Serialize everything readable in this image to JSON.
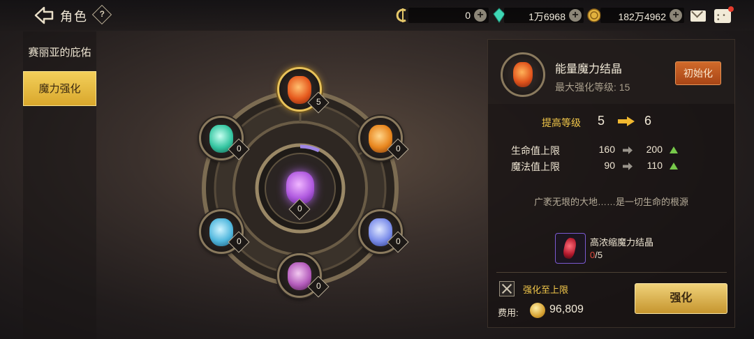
{
  "header": {
    "title": "角色",
    "help": "?"
  },
  "resources": [
    {
      "name": "crystal-currency",
      "value": "0"
    },
    {
      "name": "gem-currency",
      "value": "1万6968"
    },
    {
      "name": "gold-currency",
      "value": "182万4962"
    }
  ],
  "sidebar": {
    "items": [
      {
        "label": "赛丽亚的庇佑"
      },
      {
        "label": "魔力强化"
      }
    ]
  },
  "wheel": {
    "center_level": "0",
    "slots": [
      {
        "level": "5",
        "color": "#ff8a2a"
      },
      {
        "level": "0",
        "color": "#ffa83a"
      },
      {
        "level": "0",
        "color": "#8fa8ff"
      },
      {
        "level": "0",
        "color": "#c070c8"
      },
      {
        "level": "0",
        "color": "#6ecfe6"
      },
      {
        "level": "0",
        "color": "#4ad6b4"
      }
    ]
  },
  "detail": {
    "name": "能量魔力结晶",
    "max_level": "最大强化等级: 15",
    "init_label": "初始化",
    "upgrade_label": "提高等级",
    "from_level": "5",
    "to_level": "6",
    "stats": [
      {
        "name": "生命值上限",
        "from": "160",
        "to": "200"
      },
      {
        "name": "魔法值上限",
        "from": "90",
        "to": "110"
      }
    ],
    "flavor": "广袤无垠的大地……是一切生命的根源",
    "material": {
      "name": "高浓缩魔力结晶",
      "have": "0",
      "need": "/5"
    },
    "max_label": "强化至上限",
    "cost_label": "费用:",
    "cost_value": "96,809",
    "enhance_label": "强化"
  }
}
